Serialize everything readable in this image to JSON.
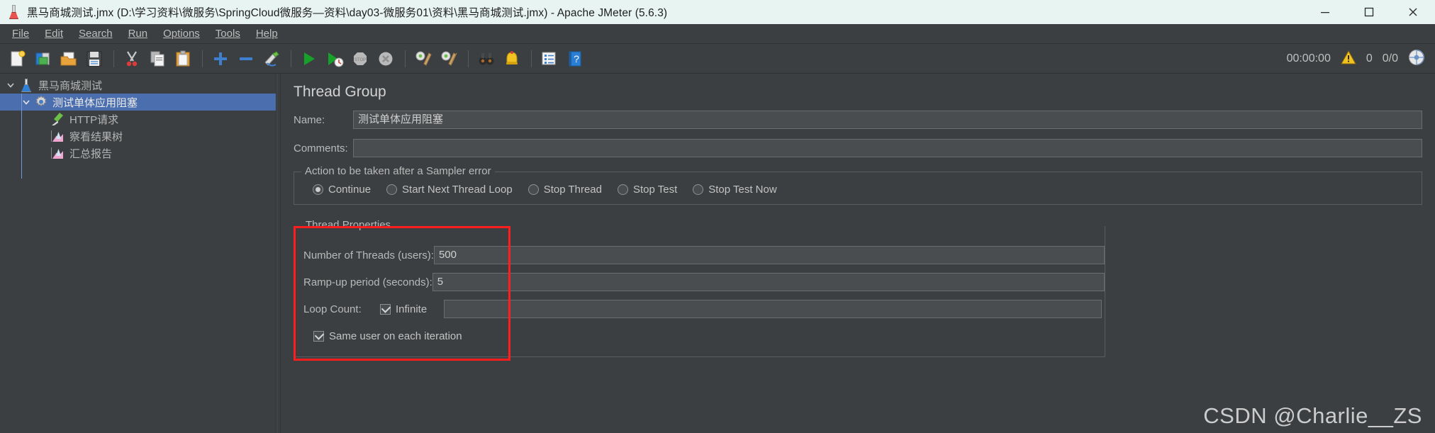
{
  "titlebar": {
    "title": "黑马商城测试.jmx (D:\\学习资料\\微服务\\SpringCloud微服务—资料\\day03-微服务01\\资料\\黑马商城测试.jmx) - Apache JMeter (5.6.3)",
    "app_icon": "jmeter-flask-icon",
    "minimize": "minimize-icon",
    "maximize": "maximize-icon",
    "close": "close-icon"
  },
  "menubar": {
    "items": [
      {
        "label": "File"
      },
      {
        "label": "Edit"
      },
      {
        "label": "Search"
      },
      {
        "label": "Run"
      },
      {
        "label": "Options"
      },
      {
        "label": "Tools"
      },
      {
        "label": "Help"
      }
    ]
  },
  "toolbar": {
    "buttons": [
      {
        "name": "new-icon",
        "title": "New"
      },
      {
        "name": "templates-icon",
        "title": "Templates"
      },
      {
        "name": "open-icon",
        "title": "Open"
      },
      {
        "name": "save-icon",
        "title": "Save Test Plan"
      },
      {
        "name": "cut-icon",
        "title": "Cut"
      },
      {
        "name": "copy-icon",
        "title": "Copy"
      },
      {
        "name": "paste-icon",
        "title": "Paste"
      },
      {
        "name": "expand-icon",
        "title": "Expand All"
      },
      {
        "name": "collapse-icon",
        "title": "Collapse All"
      },
      {
        "name": "toggle-icon",
        "title": "Toggle"
      },
      {
        "name": "start-icon",
        "title": "Start"
      },
      {
        "name": "start-no-timers-icon",
        "title": "Start no pauses"
      },
      {
        "name": "stop-icon",
        "title": "Stop"
      },
      {
        "name": "shutdown-icon",
        "title": "Shutdown"
      },
      {
        "name": "clear-icon",
        "title": "Clear"
      },
      {
        "name": "clear-all-icon",
        "title": "Clear All"
      },
      {
        "name": "search-icon",
        "title": "Search"
      },
      {
        "name": "reset-search-icon",
        "title": "Reset Search"
      },
      {
        "name": "function-helper-icon",
        "title": "Function Helper Dialog"
      },
      {
        "name": "help-icon",
        "title": "Help"
      }
    ],
    "status": {
      "elapsed": "00:00:00",
      "warning_icon": "warning-triangle-icon",
      "warning_count": "0",
      "threads": "0/0",
      "connection_icon": "remote-engine-icon"
    }
  },
  "tree": {
    "nodes": [
      {
        "label": "黑马商城测试",
        "icon": "test-plan-flask-icon",
        "depth": 0,
        "expanded": true,
        "selected": false
      },
      {
        "label": "测试单体应用阻塞",
        "icon": "thread-group-gear-icon",
        "depth": 1,
        "expanded": true,
        "selected": true
      },
      {
        "label": "HTTP请求",
        "icon": "http-sampler-pipette-icon",
        "depth": 2,
        "expanded": null,
        "selected": false
      },
      {
        "label": "察看结果树",
        "icon": "view-results-tree-icon",
        "depth": 2,
        "expanded": null,
        "selected": false
      },
      {
        "label": "汇总报告",
        "icon": "summary-report-icon",
        "depth": 2,
        "expanded": null,
        "selected": false
      }
    ]
  },
  "main": {
    "panel_title": "Thread Group",
    "name_label": "Name:",
    "name_value": "测试单体应用阻塞",
    "comments_label": "Comments:",
    "comments_value": "",
    "sampler_error": {
      "group_title": "Action to be taken after a Sampler error",
      "options": [
        {
          "label": "Continue",
          "selected": true
        },
        {
          "label": "Start Next Thread Loop",
          "selected": false
        },
        {
          "label": "Stop Thread",
          "selected": false
        },
        {
          "label": "Stop Test",
          "selected": false
        },
        {
          "label": "Stop Test Now",
          "selected": false
        }
      ]
    },
    "thread_properties": {
      "group_title": "Thread Properties",
      "num_threads_label": "Number of Threads (users):",
      "num_threads_value": "500",
      "ramp_up_label": "Ramp-up period (seconds):",
      "ramp_up_value": "5",
      "loop_count_label": "Loop Count:",
      "loop_infinite_label": "Infinite",
      "loop_infinite_checked": true,
      "loop_count_value": "",
      "same_user_label": "Same user on each iteration",
      "same_user_checked": true,
      "highlight_color": "#ff1d1d"
    }
  },
  "watermark": {
    "text": "CSDN @Charlie__ZS"
  }
}
